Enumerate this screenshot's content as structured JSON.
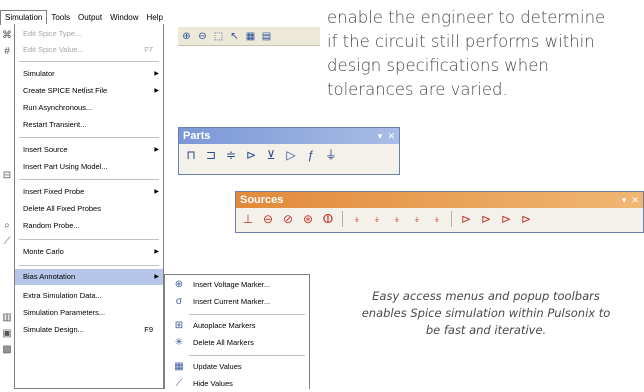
{
  "menubar": {
    "items": [
      {
        "label": "Simulation",
        "open": true
      },
      {
        "label": "Tools"
      },
      {
        "label": "Output"
      },
      {
        "label": "Window"
      },
      {
        "label": "Help"
      }
    ]
  },
  "toolstrip": {
    "icons": [
      "zoom-in-icon",
      "zoom-out-icon",
      "select-icon",
      "pointer-icon",
      "grid-icon",
      "layer-icon"
    ]
  },
  "simulation_menu": {
    "items": [
      {
        "label": "Edit Spice Type...",
        "disabled": true
      },
      {
        "label": "Edit Spice Value...",
        "shortcut": "F7",
        "disabled": true
      },
      {
        "label": "Simulator",
        "submenu": true
      },
      {
        "label": "Create SPICE Netlist File",
        "submenu": true
      },
      {
        "label": "Run Asynchronous..."
      },
      {
        "label": "Restart Transient..."
      },
      {
        "label": "Insert Source",
        "submenu": true
      },
      {
        "label": "Insert Part Using Model..."
      },
      {
        "label": "Insert Fixed Probe",
        "submenu": true
      },
      {
        "label": "Delete All Fixed Probes"
      },
      {
        "label": "Random Probe..."
      },
      {
        "label": "Monte Carlo",
        "submenu": true
      },
      {
        "label": "Bias Annotation",
        "submenu": true,
        "selected": true
      },
      {
        "label": "Extra Simulation Data..."
      },
      {
        "label": "Simulation Parameters..."
      },
      {
        "label": "Simulate Design...",
        "shortcut": "F9"
      }
    ]
  },
  "bias_submenu": {
    "items": [
      {
        "label": "Insert Voltage Marker...",
        "icon": "voltage-marker-icon"
      },
      {
        "label": "Insert Current Marker...",
        "icon": "current-marker-icon"
      },
      {
        "label": "Autoplace Markers",
        "icon": "autoplace-icon"
      },
      {
        "label": "Delete All Markers",
        "icon": "delete-markers-icon"
      },
      {
        "label": "Update Values",
        "icon": "update-values-icon"
      },
      {
        "label": "Hide Values",
        "icon": "hide-values-icon"
      }
    ]
  },
  "paragraph": {
    "lines": [
      "enable the engineer to determine",
      "if the circuit still performs within",
      "design specifications when",
      "tolerances are varied."
    ]
  },
  "caption": {
    "lines": [
      "Easy access menus and popup toolbars",
      "enables Spice simulation within Pulsonix to",
      "be fast and iterative."
    ]
  },
  "parts_toolbar": {
    "title": "Parts",
    "controls": [
      "▾",
      "✕"
    ],
    "buttons": [
      "resistor-icon",
      "capacitor-icon",
      "inductor-icon",
      "diode-icon",
      "transistor-icon",
      "opamp-icon",
      "function-icon",
      "ground-icon"
    ]
  },
  "sources_toolbar": {
    "title": "Sources",
    "controls": [
      "▾",
      "✕"
    ],
    "buttons": [
      "battery-icon",
      "dc-source-icon",
      "ac-source-icon",
      "pulse-source-icon",
      "sine-source-icon",
      "controlled-source-1-icon",
      "controlled-source-2-icon",
      "controlled-source-3-icon",
      "controlled-source-4-icon",
      "controlled-source-5-icon",
      "dependent-source-1-icon",
      "dependent-source-2-icon",
      "dependent-source-3-icon",
      "dependent-source-4-icon"
    ]
  },
  "colors": {
    "menu_selection": "#b5c6e8",
    "parts_title": "#7b97d6",
    "sources_title": "#e28a3a",
    "source_icon": "#c0392b"
  }
}
